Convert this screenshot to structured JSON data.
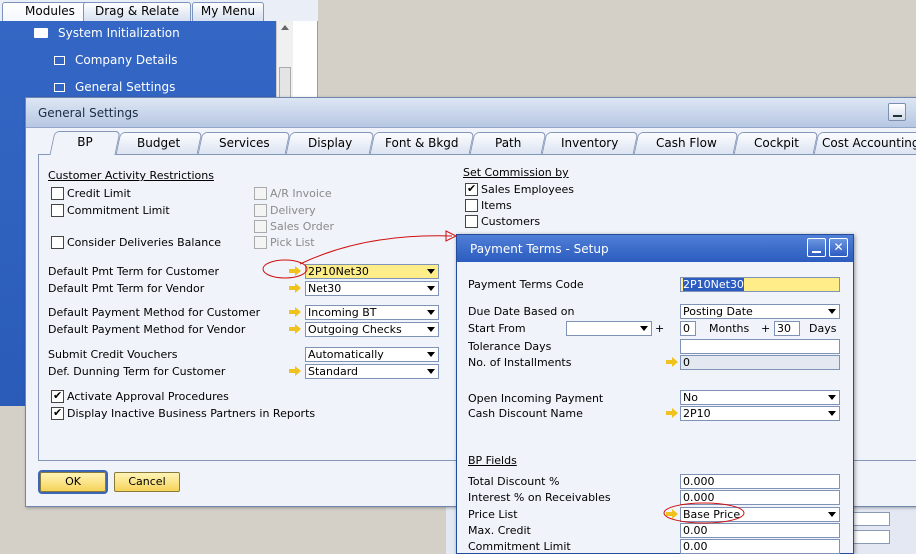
{
  "main_menu": {
    "tabs": [
      "Modules",
      "Drag & Relate",
      "My Menu"
    ],
    "items": [
      "System Initialization",
      "Company Details",
      "General Settings"
    ]
  },
  "general_settings": {
    "title": "General Settings",
    "tabs": [
      "BP",
      "Budget",
      "Services",
      "Display",
      "Font & Bkgd",
      "Path",
      "Inventory",
      "Cash Flow",
      "Cockpit",
      "Cost Accounting"
    ],
    "customer_activity": {
      "heading": "Customer Activity Restrictions",
      "credit_limit": "Credit Limit",
      "commitment_limit": "Commitment Limit",
      "consider_deliveries": "Consider Deliveries Balance",
      "ar_invoice": "A/R Invoice",
      "delivery": "Delivery",
      "sales_order": "Sales Order",
      "pick_list": "Pick List"
    },
    "commission": {
      "heading": "Set Commission by",
      "sales_employees": "Sales Employees",
      "items": "Items",
      "customers": "Customers"
    },
    "fields": {
      "pmt_term_customer_label": "Default Pmt Term for Customer",
      "pmt_term_customer_value": "2P10Net30",
      "pmt_term_vendor_label": "Default Pmt Term for Vendor",
      "pmt_term_vendor_value": "Net30",
      "pay_method_customer_label": "Default Payment Method for Customer",
      "pay_method_customer_value": "Incoming BT",
      "pay_method_vendor_label": "Default Payment Method for Vendor",
      "pay_method_vendor_value": "Outgoing Checks",
      "credit_vouchers_label": "Submit Credit Vouchers",
      "credit_vouchers_value": "Automatically",
      "dunning_label": "Def. Dunning Term for Customer",
      "dunning_value": "Standard"
    },
    "activate_approval": "Activate Approval Procedures",
    "display_inactive": "Display Inactive Business Partners in Reports",
    "ok": "OK",
    "cancel": "Cancel"
  },
  "payment_terms": {
    "title": "Payment Terms - Setup",
    "code_label": "Payment Terms Code",
    "code_value": "2P10Net30",
    "due_date_label": "Due Date Based on",
    "due_date_value": "Posting Date",
    "start_from_label": "Start From",
    "plus": "+",
    "months_value": "0",
    "months_label": "Months",
    "days_value": "30",
    "days_label": "Days",
    "tolerance_label": "Tolerance Days",
    "installments_label": "No. of Installments",
    "installments_value": "0",
    "open_incoming_label": "Open Incoming Payment",
    "open_incoming_value": "No",
    "cash_discount_label": "Cash Discount Name",
    "cash_discount_value": "2P10",
    "bp_fields_heading": "BP Fields",
    "total_discount_label": "Total Discount %",
    "total_discount_value": "0.000",
    "interest_label": "Interest % on Receivables",
    "interest_value": "0.000",
    "price_list_label": "Price List",
    "price_list_value": "Base Price",
    "max_credit_label": "Max. Credit",
    "max_credit_value": "0.00",
    "commitment_label": "Commitment Limit",
    "commitment_value": "0.00"
  },
  "colors": {
    "accent_blue": "#2c5cbf",
    "mandatory_yellow": "#ffed8a",
    "annotation_red": "#d01010",
    "link_arrow_yellow": "#f0c21d"
  }
}
